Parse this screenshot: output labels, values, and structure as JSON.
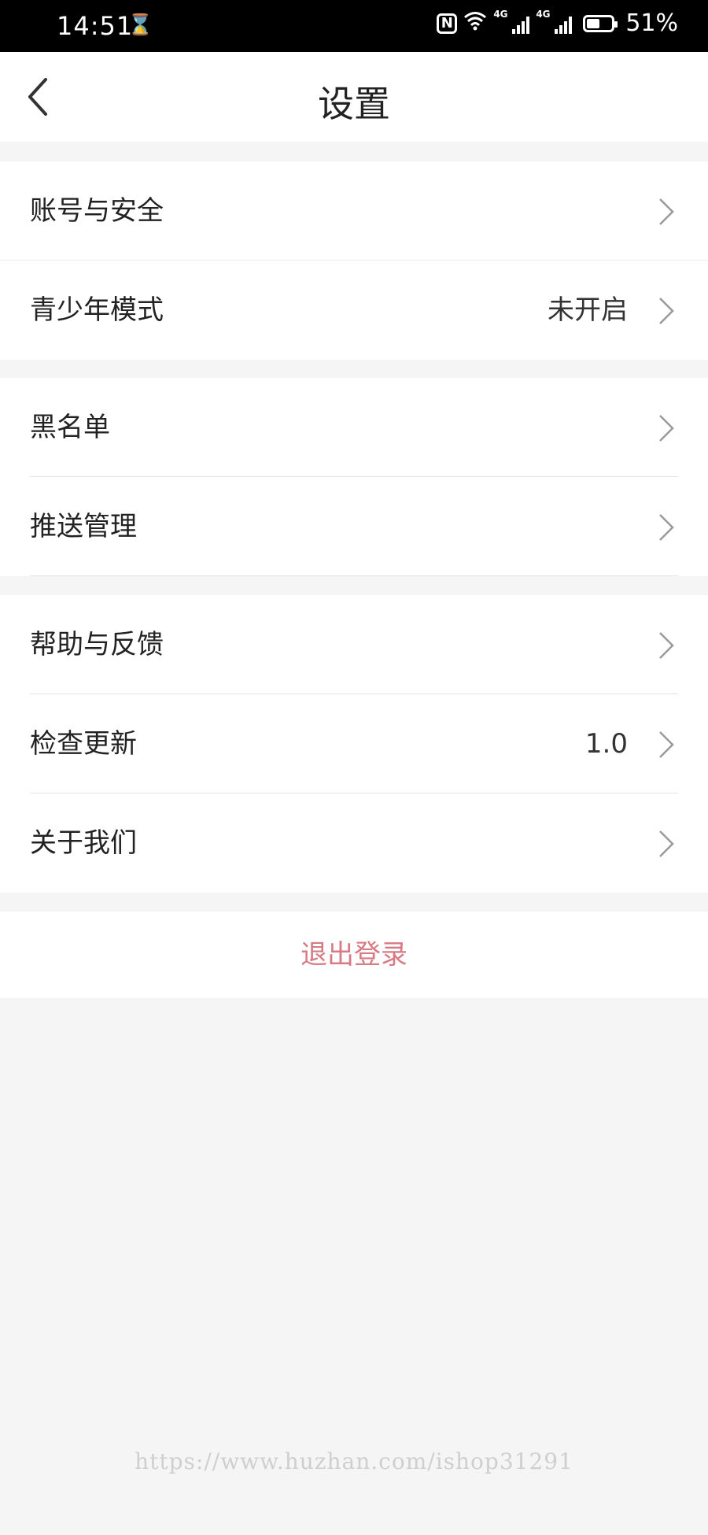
{
  "status_bar": {
    "time": "14:51",
    "network_1": "4G",
    "network_2": "4G",
    "battery_percent": "51%",
    "battery_level": 0.51
  },
  "header": {
    "title": "设置"
  },
  "groups": [
    {
      "items": [
        {
          "label": "账号与安全",
          "value": ""
        },
        {
          "label": "青少年模式",
          "value": "未开启"
        }
      ]
    },
    {
      "items": [
        {
          "label": "黑名单",
          "value": ""
        },
        {
          "label": "推送管理",
          "value": ""
        }
      ]
    },
    {
      "items": [
        {
          "label": "帮助与反馈",
          "value": ""
        },
        {
          "label": "检查更新",
          "value": "1.0"
        },
        {
          "label": "关于我们",
          "value": ""
        }
      ]
    }
  ],
  "logout_label": "退出登录",
  "watermark": "https://www.huzhan.com/ishop31291",
  "colors": {
    "logout": "#d77a84",
    "background": "#f5f5f5"
  }
}
